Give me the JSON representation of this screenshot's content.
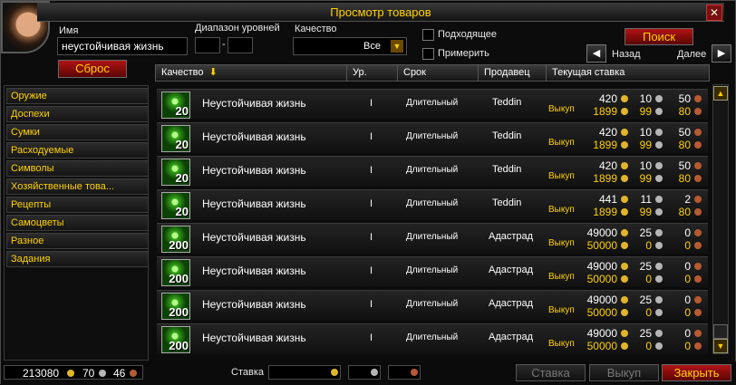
{
  "window": {
    "title": "Просмотр товаров"
  },
  "search": {
    "name_label": "Имя",
    "name_value": "неустойчивая жизнь",
    "level_range_label": "Диапазон уровней",
    "level_min": "",
    "level_sep": "-",
    "level_max": "",
    "quality_label": "Качество",
    "quality_value": "Все",
    "usable_label": "Подходящее",
    "display_on_char_label": "Примерить",
    "reset_label": "Сброс",
    "search_label": "Поиск",
    "prev_label": "Назад",
    "next_label": "Далее"
  },
  "categories": [
    "Оружие",
    "Доспехи",
    "Сумки",
    "Расходуемые",
    "Символы",
    "Хозяйственные това...",
    "Рецепты",
    "Самоцветы",
    "Разное",
    "Задания"
  ],
  "columns": {
    "quality": "Качество",
    "level": "Ур.",
    "time": "Срок",
    "seller": "Продавец",
    "bid": "Текущая ставка"
  },
  "rows": [
    {
      "count": "20",
      "name": "Неустойчивая жизнь",
      "level": "I",
      "time": "Длительный",
      "seller": "Teddin",
      "buyout_label": "Выкуп",
      "bid": {
        "g": "420",
        "s": "10",
        "c": "50"
      },
      "buyout": {
        "g": "1899",
        "s": "99",
        "c": "80"
      }
    },
    {
      "count": "20",
      "name": "Неустойчивая жизнь",
      "level": "I",
      "time": "Длительный",
      "seller": "Teddin",
      "buyout_label": "Выкуп",
      "bid": {
        "g": "420",
        "s": "10",
        "c": "50"
      },
      "buyout": {
        "g": "1899",
        "s": "99",
        "c": "80"
      }
    },
    {
      "count": "20",
      "name": "Неустойчивая жизнь",
      "level": "I",
      "time": "Длительный",
      "seller": "Teddin",
      "buyout_label": "Выкуп",
      "bid": {
        "g": "420",
        "s": "10",
        "c": "50"
      },
      "buyout": {
        "g": "1899",
        "s": "99",
        "c": "80"
      }
    },
    {
      "count": "20",
      "name": "Неустойчивая жизнь",
      "level": "I",
      "time": "Длительный",
      "seller": "Teddin",
      "buyout_label": "Выкуп",
      "bid": {
        "g": "441",
        "s": "11",
        "c": "2"
      },
      "buyout": {
        "g": "1899",
        "s": "99",
        "c": "80"
      }
    },
    {
      "count": "200",
      "name": "Неустойчивая жизнь",
      "level": "I",
      "time": "Длительный",
      "seller": "Адастрад",
      "buyout_label": "Выкуп",
      "bid": {
        "g": "49000",
        "s": "25",
        "c": "0"
      },
      "buyout": {
        "g": "50000",
        "s": "0",
        "c": "0"
      }
    },
    {
      "count": "200",
      "name": "Неустойчивая жизнь",
      "level": "I",
      "time": "Длительный",
      "seller": "Адастрад",
      "buyout_label": "Выкуп",
      "bid": {
        "g": "49000",
        "s": "25",
        "c": "0"
      },
      "buyout": {
        "g": "50000",
        "s": "0",
        "c": "0"
      }
    },
    {
      "count": "200",
      "name": "Неустойчивая жизнь",
      "level": "I",
      "time": "Длительный",
      "seller": "Адастрад",
      "buyout_label": "Выкуп",
      "bid": {
        "g": "49000",
        "s": "25",
        "c": "0"
      },
      "buyout": {
        "g": "50000",
        "s": "0",
        "c": "0"
      }
    },
    {
      "count": "200",
      "name": "Неустойчивая жизнь",
      "level": "I",
      "time": "Длительный",
      "seller": "Адастрад",
      "buyout_label": "Выкуп",
      "bid": {
        "g": "49000",
        "s": "25",
        "c": "0"
      },
      "buyout": {
        "g": "50000",
        "s": "0",
        "c": "0"
      }
    }
  ],
  "footer": {
    "money": {
      "g": "213080",
      "s": "70",
      "c": "46"
    },
    "bid_label": "Ставка",
    "bid_button": "Ставка",
    "buyout_button": "Выкуп",
    "close_button": "Закрыть"
  },
  "colors": {
    "gold_text": "#ffd100",
    "red_button": "#b01414"
  }
}
